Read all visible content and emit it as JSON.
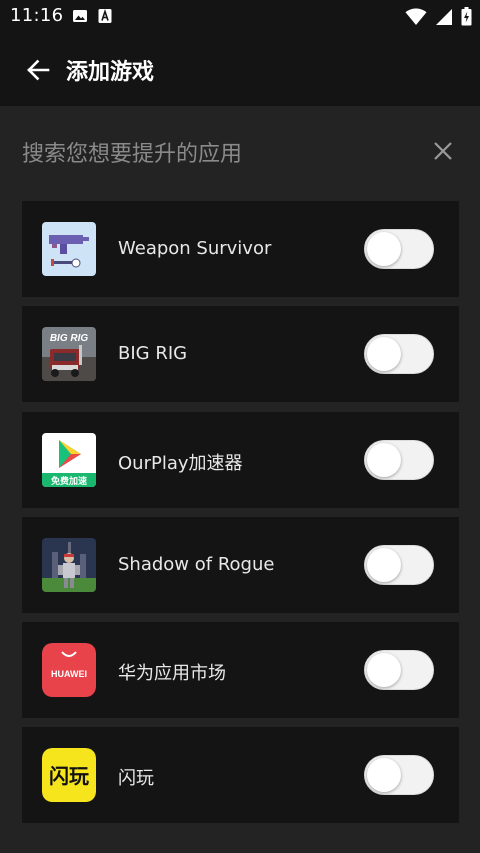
{
  "status_bar": {
    "time": "11:16",
    "left_icons": [
      "image-icon",
      "text-a-icon"
    ],
    "right_icons": [
      "wifi-icon",
      "cellular-signal-icon",
      "battery-icon"
    ]
  },
  "header": {
    "back_icon": "arrow-left-icon",
    "title": "添加游戏"
  },
  "search": {
    "placeholder": "搜索您想要提升的应用",
    "close_icon": "close-icon"
  },
  "apps": [
    {
      "name": "Weapon Survivor",
      "icon": "weapon-survivor-icon",
      "enabled": false
    },
    {
      "name": "BIG RIG",
      "icon": "big-rig-icon",
      "icon_text": "BIG RIG",
      "enabled": false
    },
    {
      "name": "OurPlay加速器",
      "icon": "ourplay-icon",
      "icon_text": "免费加速",
      "enabled": false
    },
    {
      "name": "Shadow of Rogue",
      "icon": "shadow-of-rogue-icon",
      "enabled": false
    },
    {
      "name": "华为应用市场",
      "icon": "huawei-appgallery-icon",
      "icon_text": "HUAWEI",
      "enabled": false
    },
    {
      "name": "闪玩",
      "icon": "shanwan-icon",
      "icon_text": "闪玩",
      "enabled": false
    }
  ],
  "colors": {
    "background": "#232323",
    "surface": "#141414",
    "placeholder": "#8a8a8a",
    "huawei_red": "#e8424a",
    "shanwan_yellow": "#f6e41c"
  }
}
